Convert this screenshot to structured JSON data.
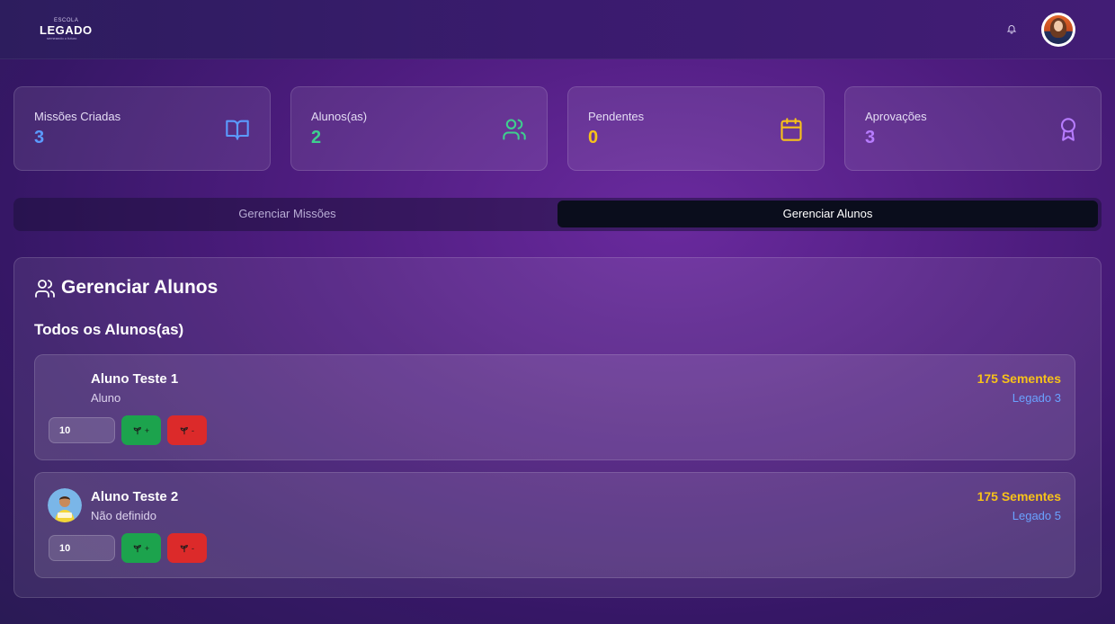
{
  "header": {
    "logo_small": "ESCOLA",
    "logo_text": "LEGADO",
    "logo_tagline": "semeando o futuro",
    "icons": [
      "bell-icon",
      "user-avatar"
    ]
  },
  "stats": [
    {
      "label": "Missões Criadas",
      "value": "3",
      "color": "#5b9bff",
      "icon": "book-icon"
    },
    {
      "label": "Alunos(as)",
      "value": "2",
      "color": "#3ecf8e",
      "icon": "users-icon"
    },
    {
      "label": "Pendentes",
      "value": "0",
      "color": "#f7c21a",
      "icon": "calendar-icon"
    },
    {
      "label": "Aprovações",
      "value": "3",
      "color": "#b77cff",
      "icon": "award-icon"
    }
  ],
  "tabs": [
    {
      "label": "Gerenciar Missões",
      "active": false
    },
    {
      "label": "Gerenciar Alunos",
      "active": true
    }
  ],
  "panel": {
    "title": "Gerenciar Alunos",
    "section_title": "Todos os Alunos(as)",
    "students": [
      {
        "name": "Aluno Teste 1",
        "role": "Aluno",
        "seeds": "175 Sementes",
        "legado": "Legado 3",
        "qty": "10",
        "plus_label": "+",
        "minus_label": "-",
        "has_avatar": false
      },
      {
        "name": "Aluno Teste 2",
        "role": "Não definido",
        "seeds": "175 Sementes",
        "legado": "Legado 5",
        "qty": "10",
        "plus_label": "+",
        "minus_label": "-",
        "has_avatar": true
      }
    ]
  },
  "colors": {
    "accent_yellow": "#f7c21a",
    "accent_blue": "#6aa2ff",
    "btn_green": "#1ca34d",
    "btn_red": "#dc2a2a",
    "active_tab": "#0a0d1c"
  }
}
